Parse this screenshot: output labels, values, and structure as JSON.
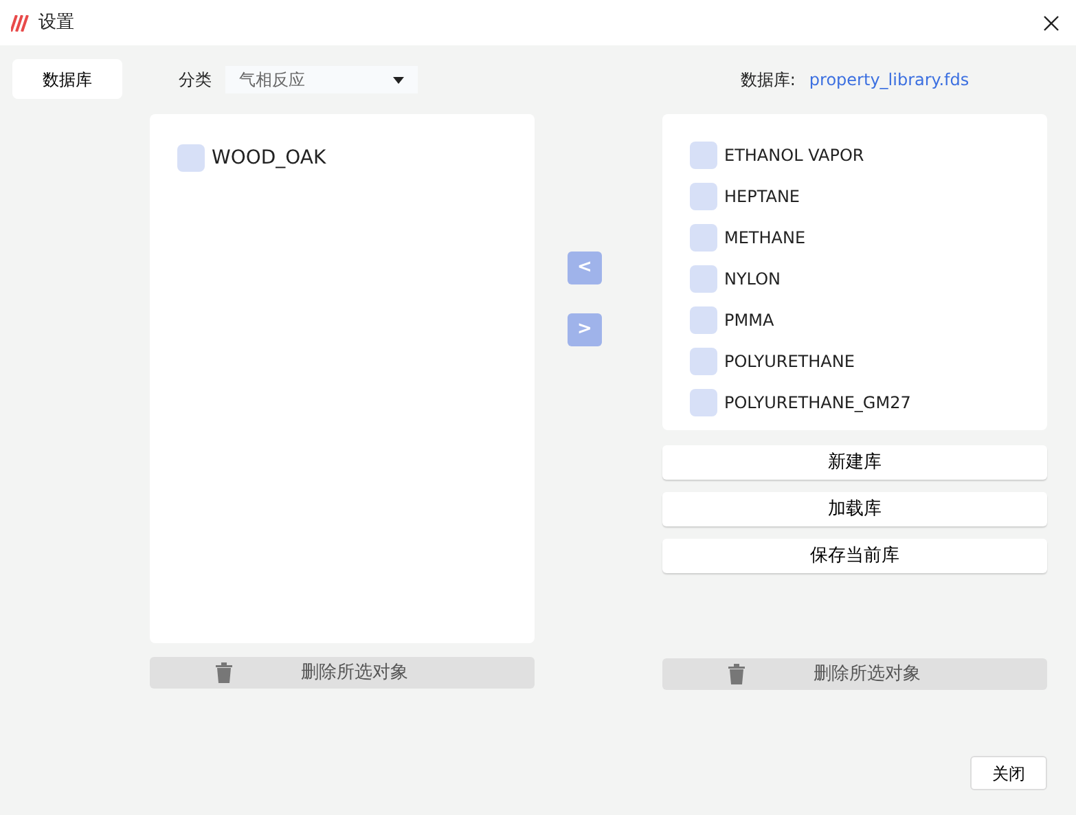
{
  "window": {
    "title": "设置"
  },
  "sidebar": {
    "items": [
      {
        "label": "数据库",
        "selected": true
      }
    ]
  },
  "category": {
    "label": "分类",
    "value": "气相反应"
  },
  "left_list": {
    "items": [
      {
        "name": "WOOD_OAK",
        "checked": false
      }
    ],
    "delete_button": "删除所选对象"
  },
  "transfer_buttons": [
    "<",
    ">"
  ],
  "database": {
    "label": "数据库:",
    "file": "property_library.fds"
  },
  "right_list": {
    "items": [
      {
        "name": "ETHANOL VAPOR",
        "checked": false
      },
      {
        "name": "HEPTANE",
        "checked": false
      },
      {
        "name": "METHANE",
        "checked": false
      },
      {
        "name": "NYLON",
        "checked": false
      },
      {
        "name": "PMMA",
        "checked": false
      },
      {
        "name": "POLYURETHANE",
        "checked": false
      },
      {
        "name": "POLYURETHANE_GM27",
        "checked": false
      }
    ],
    "actions": [
      "新建库",
      "加载库",
      "保存当前库"
    ],
    "delete_button": "删除所选对象"
  },
  "close_button": "关闭"
}
